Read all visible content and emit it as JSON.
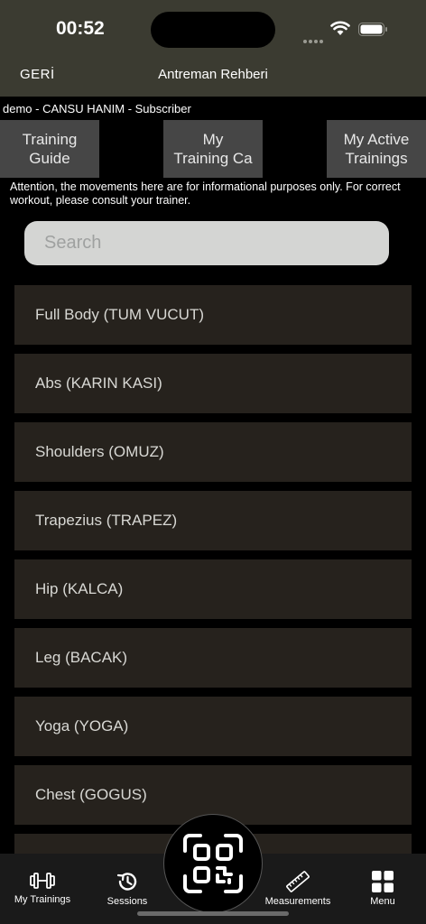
{
  "status_bar": {
    "time": "00:52"
  },
  "nav": {
    "back": "GERİ",
    "title": "Antreman Rehberi"
  },
  "user_line": "demo - CANSU HANIM  - Subscriber",
  "tabs": [
    {
      "line1": "Training",
      "line2": "Guide"
    },
    {
      "line1": "My",
      "line2": "Training Ca"
    },
    {
      "line1": "My Active",
      "line2": "Trainings"
    }
  ],
  "notice": "Attention, the movements here are for informational purposes only. For correct workout, please consult your trainer.",
  "search": {
    "placeholder": "Search"
  },
  "categories": [
    "Full Body (TUM VUCUT)",
    "Abs (KARIN KASI)",
    "Shoulders (OMUZ)",
    "Trapezius (TRAPEZ)",
    "Hip (KALCA)",
    "Leg (BACAK)",
    "Yoga (YOGA)",
    "Chest (GOGUS)"
  ],
  "tab_bar": {
    "my_trainings": "My Trainings",
    "sessions": "Sessions",
    "measurements": "Measurements",
    "menu": "Menu",
    "icons": [
      "dumbbell-icon",
      "history-icon",
      "qr-code-icon",
      "ruler-icon",
      "grid-menu-icon"
    ]
  }
}
